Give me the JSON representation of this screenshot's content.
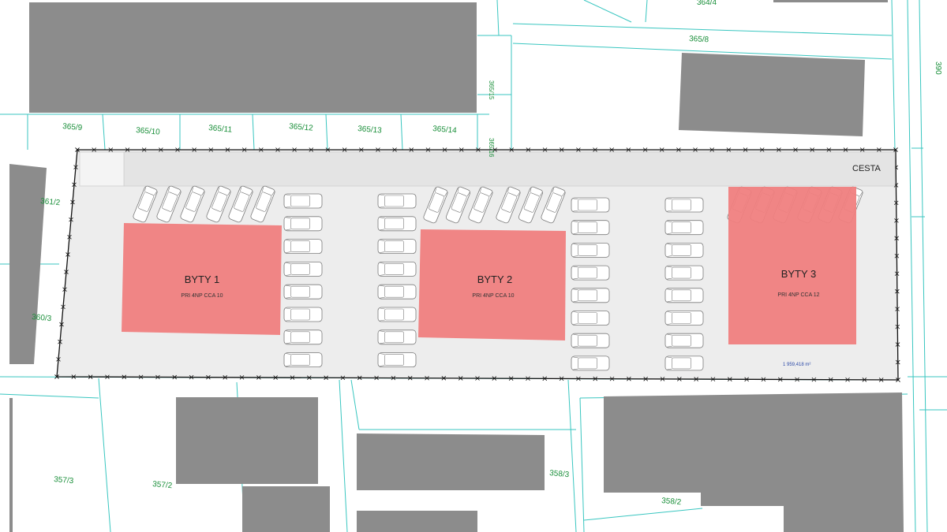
{
  "colors": {
    "neighbor_building": "#8c8c8c",
    "new_building": "#f08080",
    "site": "#ededed",
    "cadastre_line": "#39c6c0",
    "parcel_text": "#1a8f3a",
    "area_text": "#2c4aa8"
  },
  "road": {
    "label": "CESTA"
  },
  "buildings": [
    {
      "title": "BYTY 1",
      "subtitle": "PRI 4NP CCA 10"
    },
    {
      "title": "BYTY 2",
      "subtitle": "PRI 4NP CCA 10"
    },
    {
      "title": "BYTY 3",
      "subtitle": "PRI 4NP CCA 12"
    }
  ],
  "site_area": "1 959,418 m²",
  "parcels": [
    "364/4",
    "365/8",
    "365/15",
    "365/16",
    "365/9",
    "365/10",
    "365/11",
    "365/12",
    "365/13",
    "365/14",
    "361/2",
    "360/3",
    "390",
    "357/3",
    "357/2",
    "358/3",
    "358/2"
  ]
}
